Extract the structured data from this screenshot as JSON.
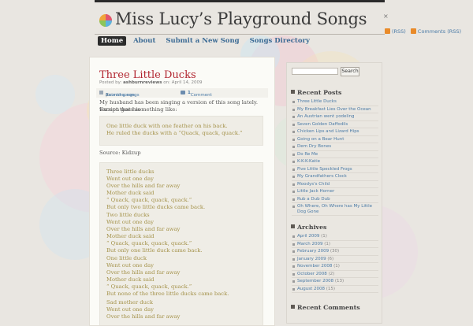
{
  "site": {
    "title": "Miss Lucy’s Playground Songs",
    "rss_label": "(RSS)",
    "comments_rss_label": "Comments (RSS)",
    "close_glyph": "×"
  },
  "nav": {
    "items": [
      "Home",
      "About",
      "Submit a New Song",
      "Songs Directory"
    ],
    "active": "Home"
  },
  "post": {
    "title": "Three Little Ducks",
    "meta_prefix": "Posted by:",
    "author": "ashburnreviews",
    "meta_on": "on:",
    "date": "April 14, 2009",
    "categories_prefix": "In:",
    "cat_1": "Animal songs",
    "cat_sep": " | ",
    "cat_2": "Counting songs",
    "comment_count": "1",
    "comment_label": "Comment",
    "intro_1": "My husband has been singing a version of this song lately. Except that his",
    "intro_2": "version goes something like:",
    "quote1": [
      "One little duck with one feather on his back.",
      "He ruled the ducks with a “Quack, quack, quack.”"
    ],
    "source": "Source: Kidzup",
    "verses": [
      "Three little ducks",
      "Went out one day",
      "Over the hills and far away",
      "Mother duck said",
      "“ Quack, quack, quack, quack.”",
      "But only two little ducks came back.",
      "Two little ducks",
      "Went out one day",
      "Over the hills and far away",
      "Mother duck said",
      "“ Quack, quack, quack, quack.”",
      "But only one little duck came back.",
      "One little duck",
      "Went out one day",
      "Over the hills and far away",
      "Mother duck said",
      "“ Quack, quack, quack, quack.”",
      "But none of the three little ducks came back.",
      "Sad mother duck",
      "Went out one day",
      "Over the hills and far away"
    ]
  },
  "sidebar": {
    "search_button": "Search",
    "recent_posts_title": "Recent Posts",
    "recent_posts": [
      "Three Little Ducks",
      "My Breakfast Lies Over the Ocean",
      "An Austrian went yodeling",
      "Seven Golden Daffodils",
      "Chicken Lips and Lizard Hips",
      "Going on a Bear Hunt",
      "Dem Dry Bones",
      "Do Re Me",
      "K-K-K-Katie",
      "Five Little Speckled Frogs",
      "My Grandfathers Clock",
      "Moodys's Child",
      "Little Jack Horner",
      "Rub a Dub Dub",
      "Oh Where, Oh Where has My Little Dog Gone"
    ],
    "archives_title": "Archives",
    "archives": [
      {
        "month": "April 2009",
        "count": "(1)"
      },
      {
        "month": "March 2009",
        "count": "(1)"
      },
      {
        "month": "February 2009",
        "count": "(30)"
      },
      {
        "month": "January 2009",
        "count": "(6)"
      },
      {
        "month": "November 2008",
        "count": "(1)"
      },
      {
        "month": "October 2008",
        "count": "(2)"
      },
      {
        "month": "September 2008",
        "count": "(13)"
      },
      {
        "month": "August 2008",
        "count": "(15)"
      }
    ],
    "recent_comments_title": "Recent Comments"
  },
  "colors": {
    "title_red": "#b1252f",
    "link_blue": "#4a7aa6",
    "quote_text": "#a4924a",
    "nav_active_bg": "#2b2b2b"
  }
}
